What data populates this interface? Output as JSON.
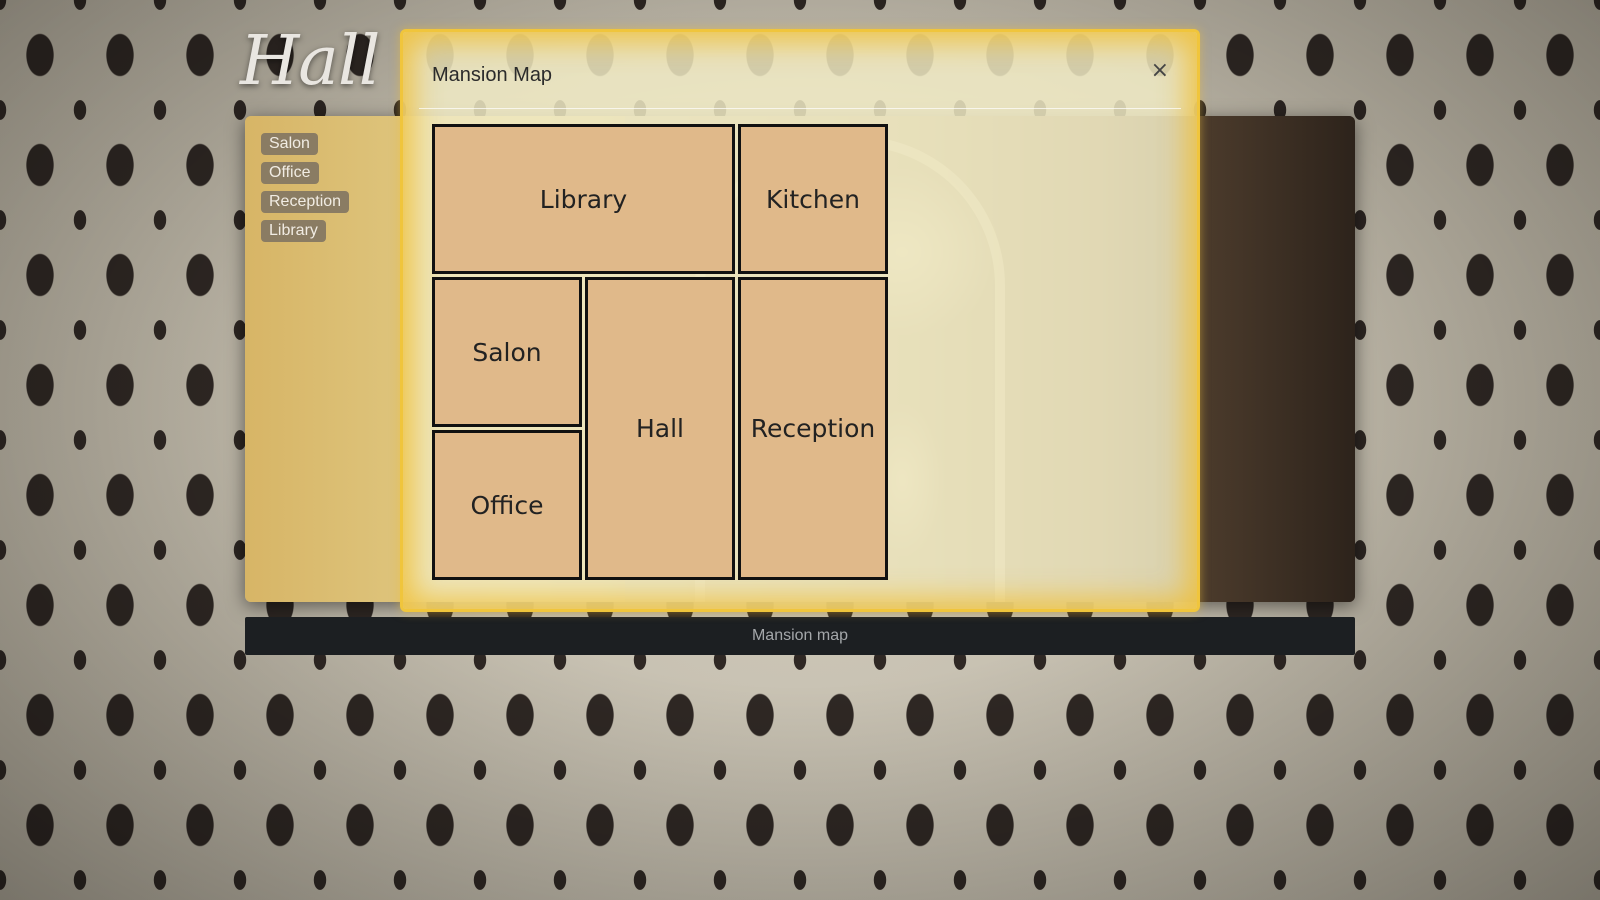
{
  "page": {
    "room_title": "Hall"
  },
  "nav": {
    "items": [
      {
        "label": "Salon"
      },
      {
        "label": "Office"
      },
      {
        "label": "Reception"
      },
      {
        "label": "Library"
      }
    ]
  },
  "footer": {
    "map_button_label": "Mansion map"
  },
  "modal": {
    "title": "Mansion Map",
    "close_label": "×",
    "accent_color": "#f0c53c",
    "rooms": {
      "library": "Library",
      "kitchen": "Kitchen",
      "salon": "Salon",
      "hall": "Hall",
      "reception": "Reception",
      "office": "Office"
    },
    "room_color": "#e0b98a"
  }
}
